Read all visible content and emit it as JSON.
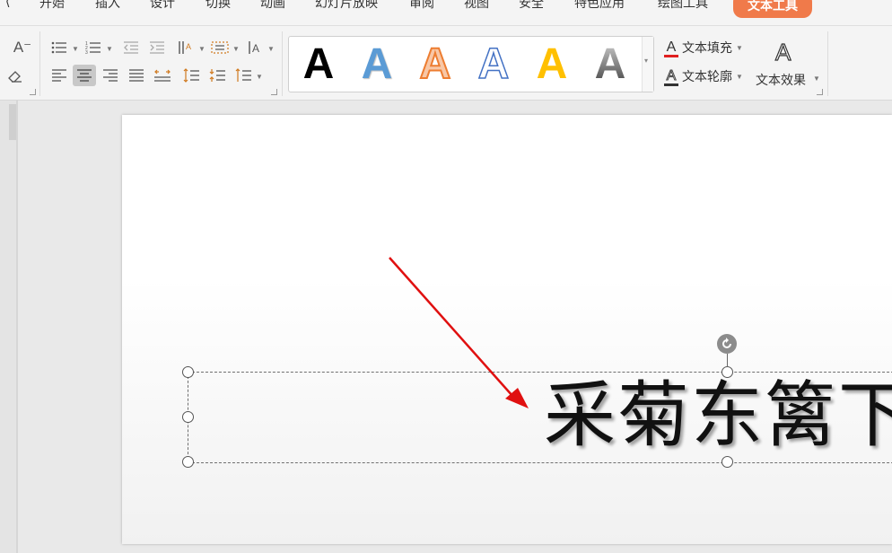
{
  "tabs": [
    {
      "label": "开始",
      "active": false
    },
    {
      "label": "插入",
      "active": false
    },
    {
      "label": "设计",
      "active": false
    },
    {
      "label": "切换",
      "active": false
    },
    {
      "label": "动画",
      "active": false
    },
    {
      "label": "幻灯片放映",
      "active": false
    },
    {
      "label": "审阅",
      "active": false
    },
    {
      "label": "视图",
      "active": false
    },
    {
      "label": "安全",
      "active": false
    },
    {
      "label": "特色应用",
      "active": false
    },
    {
      "label": "绘图工具",
      "active": false
    },
    {
      "label": "文本工具",
      "active": true
    }
  ],
  "ribbon": {
    "font_shrink_icon": "A⁻",
    "eraser_icon": "eraser-icon",
    "style_gallery": [
      {
        "glyph": "A",
        "style": "black-solid",
        "color": "#000000"
      },
      {
        "glyph": "A",
        "style": "blue-solid",
        "color": "#5b9bd5"
      },
      {
        "glyph": "A",
        "style": "orange-outline",
        "color": "#ed7d31"
      },
      {
        "glyph": "A",
        "style": "blue-outline",
        "color": "#4472c4"
      },
      {
        "glyph": "A",
        "style": "gold-solid",
        "color": "#ffc000"
      },
      {
        "glyph": "A",
        "style": "gray-gradient",
        "color": "#808080"
      }
    ],
    "text_fill_label": "文本填充",
    "text_outline_label": "文本轮廓",
    "text_effect_label": "文本效果",
    "fill_underline_color": "#e02020"
  },
  "slide": {
    "text": "采菊东篱下"
  },
  "annotation": {
    "arrow_color": "#e01010"
  }
}
